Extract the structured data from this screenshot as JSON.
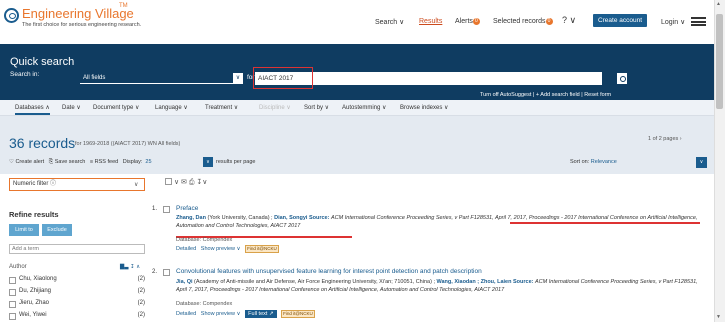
{
  "header": {
    "brand": "Engineering Village",
    "tm": "TM",
    "tagline": "The first choice for serious engineering research.",
    "nav": {
      "search": "Search ∨",
      "results": "Results",
      "alerts": "Alerts",
      "alerts_badge": "0",
      "selected": "Selected records",
      "selected_badge": "0",
      "help": "? ∨",
      "create_account": "Create account",
      "login": "Login ∨"
    }
  },
  "quick_search": {
    "title": "Quick search",
    "search_in_label": "Search in:",
    "field": "All fields",
    "for_label": "for",
    "query": "AIACT 2017",
    "autosuggest_row": "Turn off AutoSuggest  |  + Add search field  |  Reset form"
  },
  "tabs": [
    "Databases ∧",
    "Date ∨",
    "Document type ∨",
    "Language ∨",
    "Treatment ∨",
    "Discipline ∨",
    "Sort by ∨",
    "Autostemming ∨",
    "Browse indexes ∨"
  ],
  "records": {
    "count": "36 records",
    "subtitle": "for 1969-2018 ((AIACT 2017) WN All fields)",
    "pages": "1 of 2 pages ›",
    "create_alert": "♡ Create alert",
    "save_search": "⎘ Save search",
    "rss": "≡ RSS feed",
    "display_label": "Display:",
    "display_value": "25",
    "per_page": "results per page",
    "sort_on": "Sort on:",
    "sort_value": "Relevance"
  },
  "left_panel": {
    "numeric_filter": "Numeric filter ⓘ",
    "refine_title": "Refine results",
    "limit_to": "Limit to",
    "exclude": "Exclude",
    "add_term_placeholder": "Add a term",
    "author_header": "Author",
    "author_tools": "▇▃ ↧ ∧",
    "authors": [
      {
        "name": "Chu, Xiaolong",
        "count": "(2)"
      },
      {
        "name": "Du, Zhijiang",
        "count": "(2)"
      },
      {
        "name": "Jieru, Zhao",
        "count": "(2)"
      },
      {
        "name": "Wei, Yiwei",
        "count": "(2)"
      }
    ]
  },
  "results": {
    "list_tools": "∨  ✉  ⎙  ↧∨",
    "items": [
      {
        "num": "1.",
        "title": "Preface",
        "authors": "Zhang, Dan",
        "affil1": " (York University, Canada) ; ",
        "author2": "Dian, Songyi",
        "source_label": " Source: ",
        "source": "ACM International Conference Proceeding Series, v Part F128531, April 7, 2017, Proceedings - 2017 International Conference on Artificial Intelligence, Automation and Control Technologies, AIACT 2017",
        "database": "Database: Compendex",
        "detailed": "Detailed",
        "preview": "Show preview ∨",
        "findit": "Find it@NCKU"
      },
      {
        "num": "2.",
        "title": "Convolutional features with unsupervised feature learning for interest point detection and patch description",
        "authors": "Jia, Qi",
        "affil1": " (Academy of Anti-missile and Air Defense, Air Force Engineering University, Xi'an; 710051, China) ; ",
        "author2": "Wang, Xiaodan ; Zhou, Laien",
        "source_label": " Source: ",
        "source": "ACM International Conference Proceeding Series, v Part F128531, April 7, 2017, Proceedings - 2017 International Conference on Artificial Intelligence, Automation and Control Technologies, AIACT 2017",
        "database": "Database: Compendex",
        "detailed": "Detailed",
        "preview": "Show preview ∨",
        "full_text": "Full text ↗",
        "findit": "Find it@NCKU"
      }
    ]
  },
  "colors": {
    "brand_orange": "#e8762d",
    "brand_blue": "#1a5c8e",
    "search_band": "#0f3c61",
    "annotation_red": "#dd3333"
  }
}
